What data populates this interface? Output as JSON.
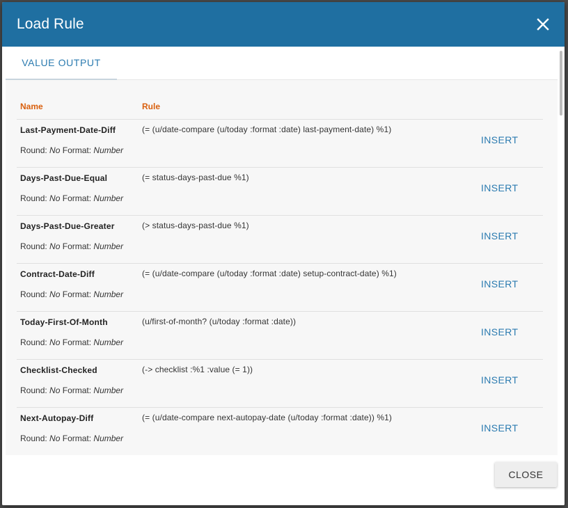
{
  "dialog": {
    "title": "Load Rule"
  },
  "tabs": [
    {
      "label": "VALUE OUTPUT"
    }
  ],
  "table": {
    "headers": {
      "name": "Name",
      "rule": "Rule"
    },
    "meta_labels": {
      "round": "Round:",
      "format": "Format:"
    },
    "insert_label": "INSERT",
    "rows": [
      {
        "name": "Last-Payment-Date-Diff",
        "rule": "(= (u/date-compare (u/today :format :date) last-payment-date) %1)",
        "round": "No",
        "format": "Number"
      },
      {
        "name": "Days-Past-Due-Equal",
        "rule": "(= status-days-past-due %1)",
        "round": "No",
        "format": "Number"
      },
      {
        "name": "Days-Past-Due-Greater",
        "rule": "(> status-days-past-due %1)",
        "round": "No",
        "format": "Number"
      },
      {
        "name": "Contract-Date-Diff",
        "rule": "(= (u/date-compare (u/today :format :date) setup-contract-date) %1)",
        "round": "No",
        "format": "Number"
      },
      {
        "name": "Today-First-Of-Month",
        "rule": "(u/first-of-month? (u/today :format :date))",
        "round": "No",
        "format": "Number"
      },
      {
        "name": "Checklist-Checked",
        "rule": "(-> checklist :%1 :value (= 1))",
        "round": "No",
        "format": "Number"
      },
      {
        "name": "Next-Autopay-Diff",
        "rule": "(= (u/date-compare next-autopay-date (u/today :format :date)) %1)",
        "round": "No",
        "format": "Number"
      }
    ]
  },
  "footer": {
    "close_label": "CLOSE"
  },
  "colors": {
    "header_bg": "#1f6fa1",
    "accent": "#2b7bb0",
    "column_header": "#d9600e"
  },
  "icons": {
    "close": "close-icon"
  }
}
